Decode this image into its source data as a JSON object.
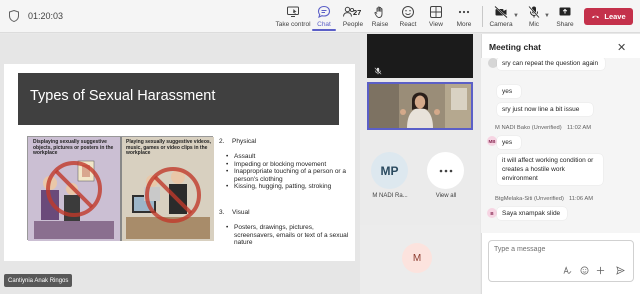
{
  "meeting": {
    "timer": "01:20:03",
    "presenter_name": "Cantiynia Anak Ringos"
  },
  "toolbar": {
    "take_control": "Take control",
    "chat": "Chat",
    "people": "People",
    "people_count": "27",
    "raise": "Raise",
    "react": "React",
    "view": "View",
    "more": "More",
    "camera": "Camera",
    "mic": "Mic",
    "share": "Share",
    "leave": "Leave"
  },
  "slide": {
    "title": "Types of Sexual Harassment",
    "cartoon_caption_left": "Displaying sexually suggestive objects, pictures or posters in the workplace",
    "cartoon_caption_right": "Playing sexually suggestive videos, music, games or video clips in the workplace",
    "section1_num": "2.",
    "section1_head": "Physical",
    "physical_items": [
      "Assault",
      "Impeding or blocking movement",
      "Inappropriate touching of a person or a person's clothing",
      "Kissing, hugging, patting, stroking"
    ],
    "section2_num": "3.",
    "section2_head": "Visual",
    "visual_items": [
      "Posters, drawings, pictures, screensavers, emails or text of a sexual nature"
    ]
  },
  "participants": {
    "avatar1_initials": "MP",
    "avatar1_name": "M NADI Ra...",
    "view_all": "View all",
    "avatar2_initials": "M"
  },
  "chat": {
    "title": "Meeting chat",
    "messages": [
      {
        "text": "sry can repeat the question again"
      },
      {
        "text": "yes"
      },
      {
        "text": "sry just now line a bit issue"
      },
      {
        "sender": "M NADI Bako (Unverified)",
        "time": "11:02 AM",
        "initials": "MB",
        "text": "yes"
      },
      {
        "text": "it will affect working condition or creates a hostile work environment"
      },
      {
        "sender": "BtgMelaka-Siti (Unverified)",
        "time": "11:06 AM",
        "initials": "B",
        "text": "Saya xnampak slide"
      }
    ],
    "placeholder": "Type a message"
  },
  "colors": {
    "accent": "#5b5fc7",
    "leave": "#c4314b",
    "slide_title_bg": "#404040"
  }
}
